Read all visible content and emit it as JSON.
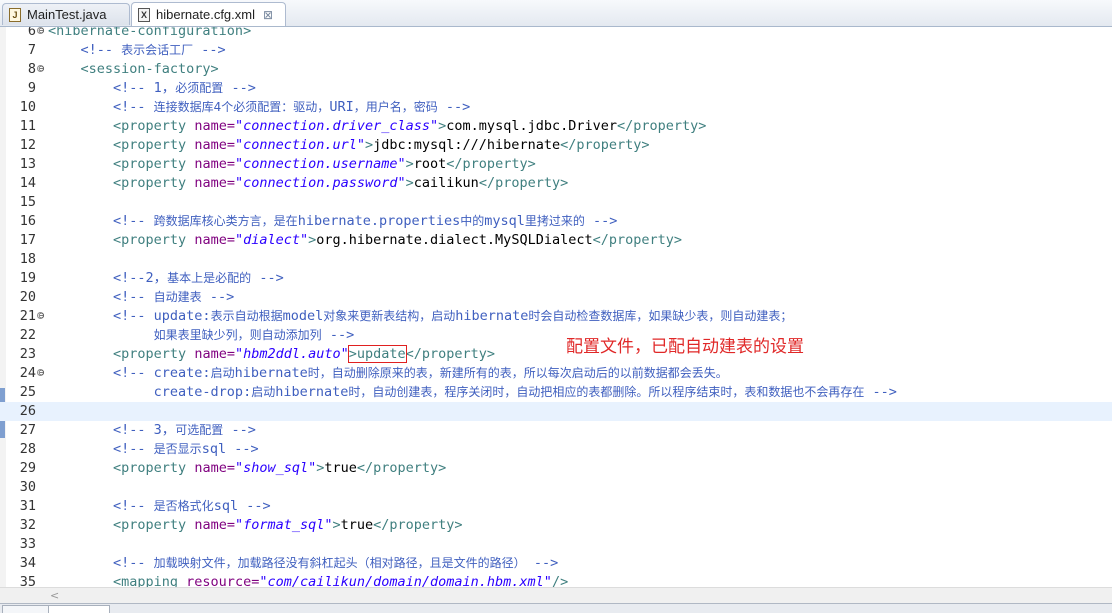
{
  "tabs": [
    {
      "label": "MainTest.java",
      "icon": "java-file-icon"
    },
    {
      "label": "hibernate.cfg.xml",
      "icon": "xml-file-icon",
      "close": "⊠"
    }
  ],
  "editor_lines": [
    {
      "n": "6",
      "fold": "⊖",
      "segs": [
        [
          "t",
          "<hibernate-configuration>"
        ]
      ]
    },
    {
      "n": "7",
      "segs": [
        [
          "c",
          "    <!-- "
        ],
        [
          "c zh",
          "表示会话工厂"
        ],
        [
          "c",
          " -->"
        ]
      ]
    },
    {
      "n": "8",
      "fold": "⊖",
      "segs": [
        [
          "t",
          "    <session-factory>"
        ]
      ]
    },
    {
      "n": "9",
      "segs": [
        [
          "c",
          "        <!-- 1，"
        ],
        [
          "c zh",
          "必须配置"
        ],
        [
          "c",
          " -->"
        ]
      ]
    },
    {
      "n": "10",
      "segs": [
        [
          "c",
          "        <!-- "
        ],
        [
          "c zh",
          "连接数据库4个必须配置：驱动，"
        ],
        [
          "c",
          "URI"
        ],
        [
          "c zh",
          "，用户名，密码"
        ],
        [
          "c",
          " -->"
        ]
      ]
    },
    {
      "n": "11",
      "segs": [
        [
          "t",
          "        <property "
        ],
        [
          "a",
          "name="
        ],
        [
          "v",
          "\"connection.driver_class\""
        ],
        [
          "t",
          ">"
        ],
        [
          "txt",
          "com.mysql.jdbc.Driver"
        ],
        [
          "t",
          "</property>"
        ]
      ]
    },
    {
      "n": "12",
      "segs": [
        [
          "t",
          "        <property "
        ],
        [
          "a",
          "name="
        ],
        [
          "v",
          "\"connection.url\""
        ],
        [
          "t",
          ">"
        ],
        [
          "txt",
          "jdbc:mysql:///hibernate"
        ],
        [
          "t",
          "</property>"
        ]
      ]
    },
    {
      "n": "13",
      "segs": [
        [
          "t",
          "        <property "
        ],
        [
          "a",
          "name="
        ],
        [
          "v",
          "\"connection.username\""
        ],
        [
          "t",
          ">"
        ],
        [
          "txt",
          "root"
        ],
        [
          "t",
          "</property>"
        ]
      ]
    },
    {
      "n": "14",
      "segs": [
        [
          "t",
          "        <property "
        ],
        [
          "a",
          "name="
        ],
        [
          "v",
          "\"connection.password\""
        ],
        [
          "t",
          ">"
        ],
        [
          "txt",
          "cailikun"
        ],
        [
          "t",
          "</property>"
        ]
      ]
    },
    {
      "n": "15",
      "segs": []
    },
    {
      "n": "16",
      "segs": [
        [
          "c",
          "        <!-- "
        ],
        [
          "c zh",
          "跨数据库核心类方言，是在"
        ],
        [
          "c",
          "hibernate.properties"
        ],
        [
          "c zh",
          "中的"
        ],
        [
          "c",
          "mysql"
        ],
        [
          "c zh",
          "里拷过来的"
        ],
        [
          "c",
          " -->"
        ]
      ]
    },
    {
      "n": "17",
      "segs": [
        [
          "t",
          "        <property "
        ],
        [
          "a",
          "name="
        ],
        [
          "v",
          "\"dialect\""
        ],
        [
          "t",
          ">"
        ],
        [
          "txt",
          "org.hibernate.dialect.MySQLDialect"
        ],
        [
          "t",
          "</property>"
        ]
      ]
    },
    {
      "n": "18",
      "segs": []
    },
    {
      "n": "19",
      "segs": [
        [
          "c",
          "        <!--2，"
        ],
        [
          "c zh",
          "基本上是必配的"
        ],
        [
          "c",
          " -->"
        ]
      ]
    },
    {
      "n": "20",
      "segs": [
        [
          "c",
          "        <!-- "
        ],
        [
          "c zh",
          "自动建表"
        ],
        [
          "c",
          " -->"
        ]
      ]
    },
    {
      "n": "21",
      "fold": "⊖",
      "segs": [
        [
          "c",
          "        <!-- update:"
        ],
        [
          "c zh",
          "表示自动根据"
        ],
        [
          "c",
          "model"
        ],
        [
          "c zh",
          "对象来更新表结构，启动"
        ],
        [
          "c",
          "hibernate"
        ],
        [
          "c zh",
          "时会自动检查数据库，如果缺少表，则自动建表；"
        ]
      ]
    },
    {
      "n": "22",
      "segs": [
        [
          "c",
          "             "
        ],
        [
          "c zh",
          "如果表里缺少列，则自动添加列"
        ],
        [
          "c",
          " -->"
        ]
      ]
    },
    {
      "n": "23",
      "segs": [
        [
          "t",
          "        <property "
        ],
        [
          "a",
          "name="
        ],
        [
          "v",
          "\"hbm2ddl.auto\""
        ],
        [
          "t boxed",
          ">update"
        ],
        [
          "t",
          "</property>"
        ]
      ]
    },
    {
      "n": "24",
      "fold": "⊖",
      "segs": [
        [
          "c",
          "        <!-- create:"
        ],
        [
          "c zh",
          "启动"
        ],
        [
          "c",
          "hibernate"
        ],
        [
          "c zh",
          "时，自动删除原来的表，新建所有的表，所以每次启动后的以前数据都会丢失。"
        ]
      ]
    },
    {
      "n": "25",
      "segs": [
        [
          "c",
          "             create-drop:"
        ],
        [
          "c zh",
          "启动"
        ],
        [
          "c",
          "hibernate"
        ],
        [
          "c zh",
          "时，自动创建表，程序关闭时，自动把相应的表都删除。所以程序结束时，表和数据也不会再存在"
        ],
        [
          "c",
          " -->"
        ]
      ]
    },
    {
      "n": "26",
      "current": true,
      "segs": []
    },
    {
      "n": "27",
      "segs": [
        [
          "c",
          "        <!-- 3，"
        ],
        [
          "c zh",
          "可选配置"
        ],
        [
          "c",
          " -->"
        ]
      ]
    },
    {
      "n": "28",
      "segs": [
        [
          "c",
          "        <!-- "
        ],
        [
          "c zh",
          "是否显示"
        ],
        [
          "c",
          "sql -->"
        ]
      ]
    },
    {
      "n": "29",
      "segs": [
        [
          "t",
          "        <property "
        ],
        [
          "a",
          "name="
        ],
        [
          "v",
          "\"show_sql\""
        ],
        [
          "t",
          ">"
        ],
        [
          "txt",
          "true"
        ],
        [
          "t",
          "</property>"
        ]
      ]
    },
    {
      "n": "30",
      "segs": []
    },
    {
      "n": "31",
      "segs": [
        [
          "c",
          "        <!-- "
        ],
        [
          "c zh",
          "是否格式化"
        ],
        [
          "c",
          "sql -->"
        ]
      ]
    },
    {
      "n": "32",
      "segs": [
        [
          "t",
          "        <property "
        ],
        [
          "a",
          "name="
        ],
        [
          "v",
          "\"format_sql\""
        ],
        [
          "t",
          ">"
        ],
        [
          "txt",
          "true"
        ],
        [
          "t",
          "</property>"
        ]
      ]
    },
    {
      "n": "33",
      "segs": []
    },
    {
      "n": "34",
      "segs": [
        [
          "c",
          "        <!-- "
        ],
        [
          "c zh",
          "加载映射文件，加载路径没有斜杠起头（相对路径，且是文件的路径）"
        ],
        [
          "c",
          " -->"
        ]
      ]
    },
    {
      "n": "35",
      "segs": [
        [
          "t",
          "        <mapping "
        ],
        [
          "a",
          "resource="
        ],
        [
          "v",
          "\"com/cailikun/domain/domain.hbm.xml\""
        ],
        [
          "t",
          "/>"
        ]
      ]
    }
  ],
  "annotation": "配置文件，已配自动建表的设置",
  "scrollbar_arrow": "<",
  "colors": {
    "comment": "#3f5fbf",
    "tag": "#3f7f7f",
    "attribute": "#7f007f",
    "value": "#2a00ff",
    "annotation": "#e02828",
    "current_line": "#e8f2fe"
  }
}
